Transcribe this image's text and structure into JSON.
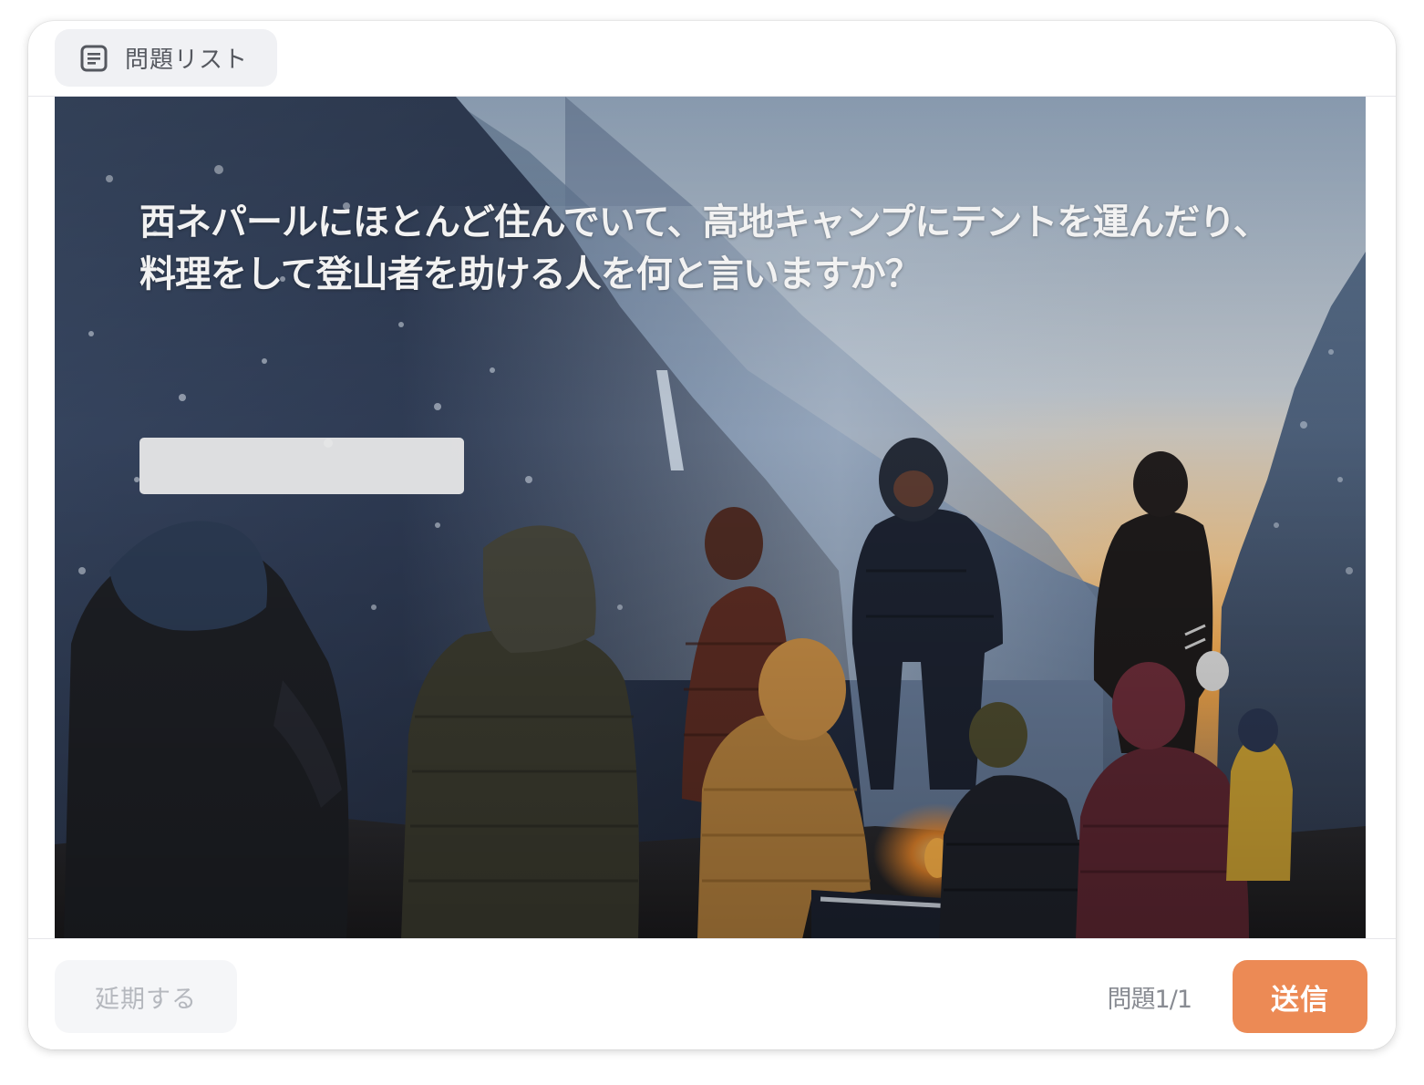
{
  "topbar": {
    "question_list_label": "問題リスト",
    "question_list_icon": "document-list-icon"
  },
  "question": {
    "text": "西ネパールにほとんど住んでいて、高地キャンプにテントを運んだり、料理をして登山者を助ける人を何と言いますか？",
    "answer_value": "",
    "image_description_icon": "mountain-campfire-photo"
  },
  "footer": {
    "postpone_label": "延期する",
    "counter": "問題1/1",
    "submit_label": "送信"
  },
  "colors": {
    "accent": "#ec8a55",
    "muted_button_bg": "#f5f6f8",
    "list_button_bg": "#f0f1f4"
  }
}
